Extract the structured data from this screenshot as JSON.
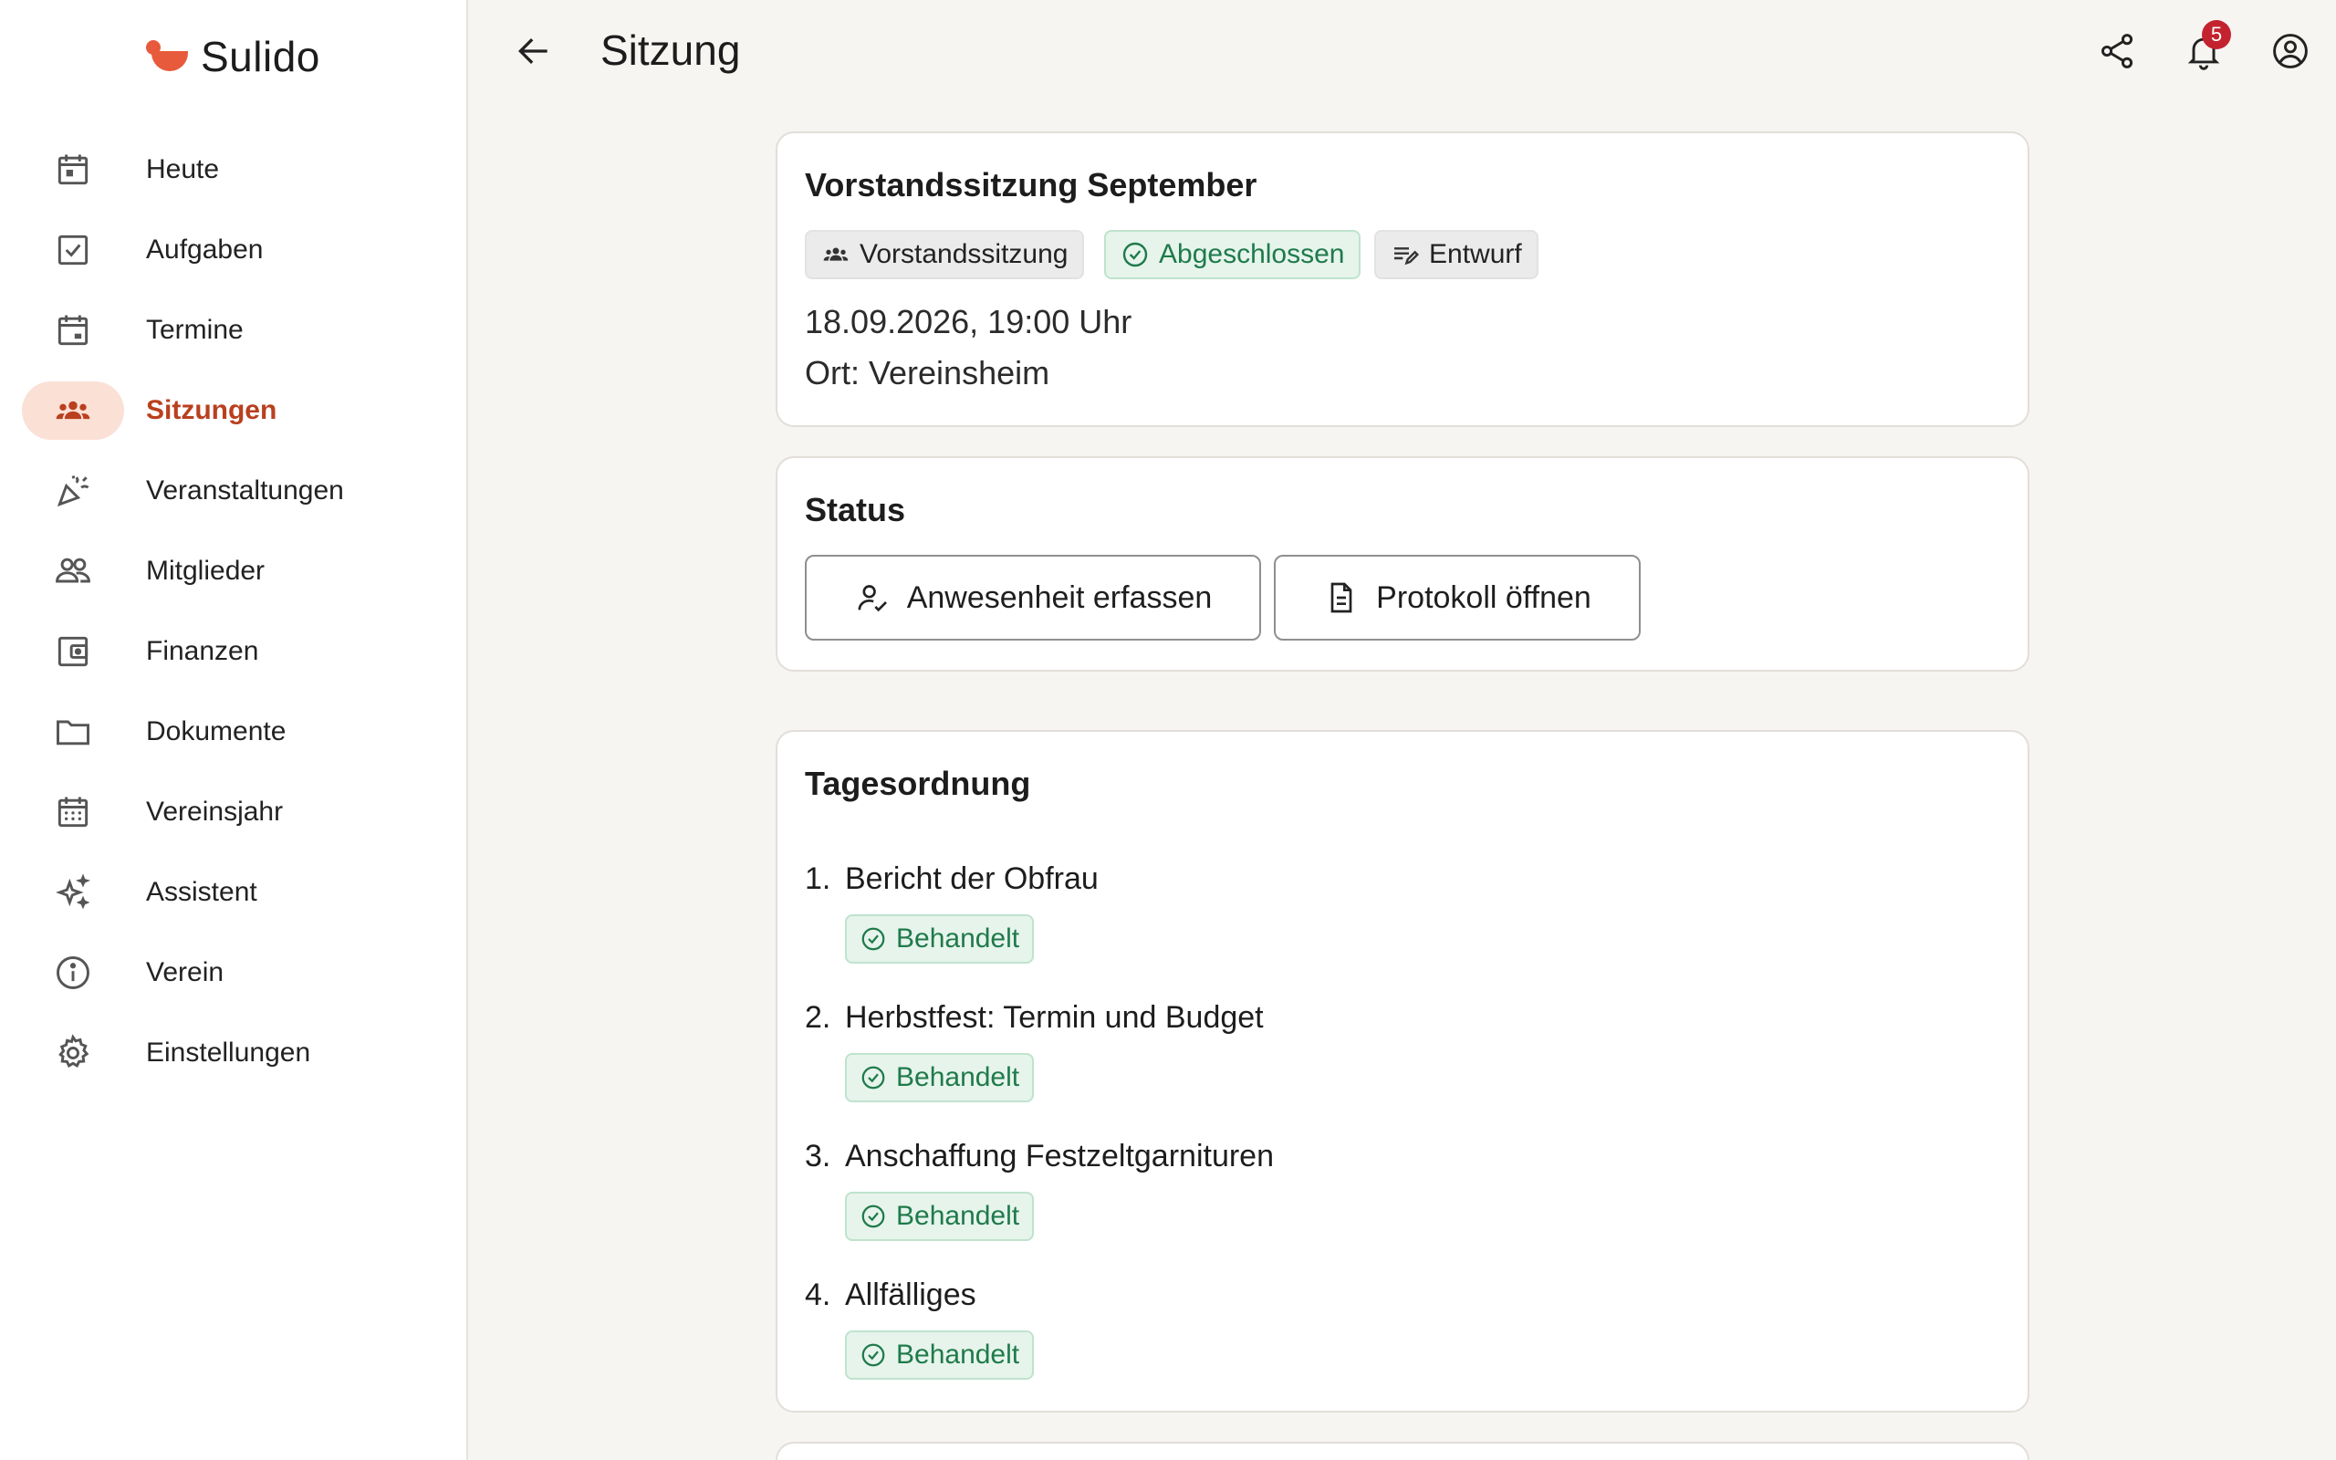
{
  "brand": {
    "name": "Sulido",
    "accent": "#e85a3c"
  },
  "sidebar": {
    "items": [
      {
        "label": "Heute",
        "icon": "calendar-today-icon"
      },
      {
        "label": "Aufgaben",
        "icon": "checkbox-icon"
      },
      {
        "label": "Termine",
        "icon": "calendar-event-icon"
      },
      {
        "label": "Sitzungen",
        "icon": "groups-icon",
        "active": true
      },
      {
        "label": "Veranstaltungen",
        "icon": "celebration-icon"
      },
      {
        "label": "Mitglieder",
        "icon": "people-icon"
      },
      {
        "label": "Finanzen",
        "icon": "wallet-icon"
      },
      {
        "label": "Dokumente",
        "icon": "folder-icon"
      },
      {
        "label": "Vereinsjahr",
        "icon": "calendar-month-icon"
      },
      {
        "label": "Assistent",
        "icon": "sparkle-icon"
      },
      {
        "label": "Verein",
        "icon": "info-icon"
      },
      {
        "label": "Einstellungen",
        "icon": "gear-icon"
      }
    ]
  },
  "header": {
    "title": "Sitzung",
    "notification_count": "5"
  },
  "meeting": {
    "title": "Vorstandssitzung September",
    "chips": {
      "type": "Vorstandssitzung",
      "status": "Abgeschlossen",
      "protocol": "Entwurf"
    },
    "datetime": "18.09.2026, 19:00 Uhr",
    "location": "Ort: Vereinsheim"
  },
  "status_card": {
    "title": "Status",
    "attendance_button": "Anwesenheit erfassen",
    "protocol_button": "Protokoll öffnen"
  },
  "agenda": {
    "title": "Tagesordnung",
    "items": [
      {
        "num": "1.",
        "title": "Bericht der Obfrau",
        "status": "Behandelt"
      },
      {
        "num": "2.",
        "title": "Herbstfest: Termin und Budget",
        "status": "Behandelt"
      },
      {
        "num": "3.",
        "title": "Anschaffung Festzeltgarnituren",
        "status": "Behandelt"
      },
      {
        "num": "4.",
        "title": "Allfälliges",
        "status": "Behandelt"
      }
    ]
  },
  "colors": {
    "active_bg": "#fbe0d6",
    "active_text": "#b9401f",
    "success": "#1f7a4a",
    "badge": "#c3232f"
  }
}
